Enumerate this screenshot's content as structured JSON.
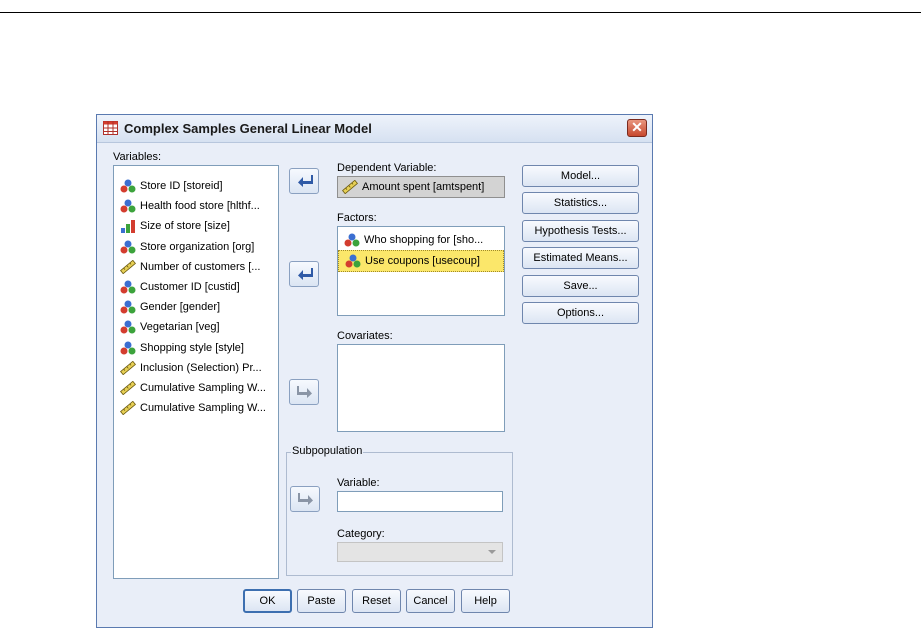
{
  "dialog": {
    "title": "Complex Samples General Linear Model",
    "close_glyph": "✕"
  },
  "variables": {
    "label": "Variables:",
    "items": [
      {
        "label": "Store ID [storeid]",
        "icon": "nominal-icon"
      },
      {
        "label": "Health food store [hlthf...",
        "icon": "nominal-icon"
      },
      {
        "label": "Size of store [size]",
        "icon": "ordinal-icon"
      },
      {
        "label": "Store organization [org]",
        "icon": "nominal-icon"
      },
      {
        "label": "Number of customers [...",
        "icon": "scale-icon"
      },
      {
        "label": "Customer ID [custid]",
        "icon": "nominal-icon"
      },
      {
        "label": "Gender [gender]",
        "icon": "nominal-icon"
      },
      {
        "label": "Vegetarian [veg]",
        "icon": "nominal-icon"
      },
      {
        "label": "Shopping style [style]",
        "icon": "nominal-icon"
      },
      {
        "label": "Inclusion (Selection) Pr...",
        "icon": "scale-icon"
      },
      {
        "label": "Cumulative Sampling W...",
        "icon": "scale-icon"
      },
      {
        "label": "Cumulative Sampling W...",
        "icon": "scale-icon"
      }
    ]
  },
  "dependent": {
    "label": "Dependent Variable:",
    "value": "Amount spent [amtspent]",
    "icon": "scale-icon"
  },
  "factors": {
    "label": "Factors:",
    "items": [
      {
        "label": "Who shopping for [sho...",
        "icon": "nominal-icon"
      },
      {
        "label": "Use coupons [usecoup]",
        "icon": "nominal-icon",
        "selected": true
      }
    ]
  },
  "covariates": {
    "label": "Covariates:"
  },
  "subpopulation": {
    "title": "Subpopulation",
    "variable_label": "Variable:",
    "variable_value": "",
    "category_label": "Category:",
    "category_value": ""
  },
  "side_buttons": [
    "Model...",
    "Statistics...",
    "Hypothesis Tests...",
    "Estimated Means...",
    "Save...",
    "Options..."
  ],
  "bottom_buttons": [
    "OK",
    "Paste",
    "Reset",
    "Cancel",
    "Help"
  ],
  "colors": {
    "accent": "#3d6fb0",
    "selection": "#fbe76a",
    "dialog_bg": "#e9eef8",
    "close": "#c7482d"
  }
}
